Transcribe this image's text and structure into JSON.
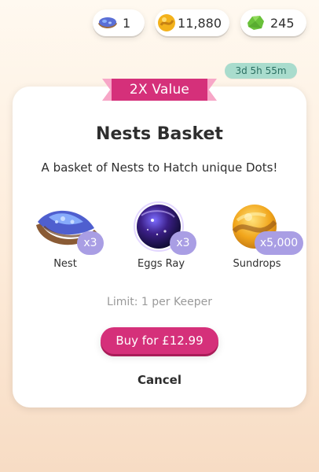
{
  "currency": {
    "nests": {
      "icon": "nest-icon",
      "value": "1"
    },
    "gold": {
      "icon": "gold-coin-icon",
      "value": "11,880"
    },
    "gems": {
      "icon": "green-gem-icon",
      "value": "245"
    }
  },
  "timer": {
    "text": "3d 5h 55m"
  },
  "offer": {
    "ribbon_text": "2X Value",
    "title": "Nests Basket",
    "subtitle": "A basket of Nests to Hatch unique Dots!",
    "items": [
      {
        "name": "Nest",
        "quantity": "x3",
        "icon": "nest-icon"
      },
      {
        "name": "Eggs Ray",
        "quantity": "x3",
        "icon": "eggs-ray-icon"
      },
      {
        "name": "Sundrops",
        "quantity": "x5,000",
        "icon": "sundrop-icon"
      }
    ],
    "limit_text": "Limit: 1 per Keeper",
    "buy_label": "Buy for £12.99",
    "cancel_label": "Cancel"
  },
  "colors": {
    "accent_pink": "#d5307a",
    "ribbon_light": "#f7a6c7",
    "qty_badge": "#a99ee4",
    "timer_bg": "#a9dccd"
  }
}
